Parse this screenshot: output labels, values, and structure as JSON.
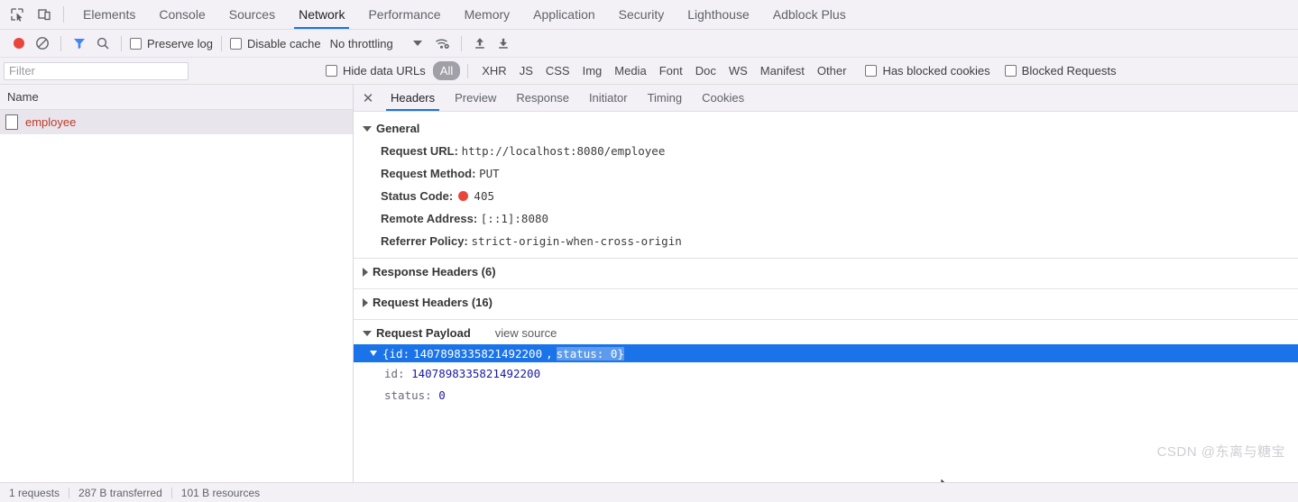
{
  "window": {
    "title": "Chrome DevTools - Network"
  },
  "tabbar": {
    "inspect_icon": "inspect-element-icon",
    "device_icon": "device-toolbar-icon",
    "tabs": [
      {
        "label": "Elements",
        "active": false
      },
      {
        "label": "Console",
        "active": false
      },
      {
        "label": "Sources",
        "active": false
      },
      {
        "label": "Network",
        "active": true
      },
      {
        "label": "Performance",
        "active": false
      },
      {
        "label": "Memory",
        "active": false
      },
      {
        "label": "Application",
        "active": false
      },
      {
        "label": "Security",
        "active": false
      },
      {
        "label": "Lighthouse",
        "active": false
      },
      {
        "label": "Adblock Plus",
        "active": false
      }
    ]
  },
  "toolbar": {
    "record_icon": "record-button-icon",
    "clear_icon": "clear-icon",
    "filter_icon": "filter-funnel-icon",
    "search_icon": "search-icon",
    "preserve_log_label": "Preserve log",
    "disable_cache_label": "Disable cache",
    "throttling_value": "No throttling",
    "throttling_caret": "chevron-down-icon",
    "network_conditions_icon": "wifi-settings-icon",
    "import_icon": "import-har-icon",
    "export_icon": "export-har-icon",
    "accent_blue": "#1a73e8",
    "record_red": "#e8453c"
  },
  "filterbar": {
    "filter_placeholder": "Filter",
    "filter_value": "",
    "hide_data_urls_label": "Hide data URLs",
    "types": [
      {
        "label": "All",
        "selected": true
      },
      {
        "label": "XHR",
        "selected": false
      },
      {
        "label": "JS",
        "selected": false
      },
      {
        "label": "CSS",
        "selected": false
      },
      {
        "label": "Img",
        "selected": false
      },
      {
        "label": "Media",
        "selected": false
      },
      {
        "label": "Font",
        "selected": false
      },
      {
        "label": "Doc",
        "selected": false
      },
      {
        "label": "WS",
        "selected": false
      },
      {
        "label": "Manifest",
        "selected": false
      },
      {
        "label": "Other",
        "selected": false
      }
    ],
    "has_blocked_cookies_label": "Has blocked cookies",
    "blocked_requests_label": "Blocked Requests"
  },
  "requestlist": {
    "column_header": "Name",
    "rows": [
      {
        "name": "employee",
        "selected": true,
        "error": true
      }
    ]
  },
  "detail": {
    "close_icon": "close-icon",
    "tabs": [
      {
        "label": "Headers",
        "active": true
      },
      {
        "label": "Preview",
        "active": false
      },
      {
        "label": "Response",
        "active": false
      },
      {
        "label": "Initiator",
        "active": false
      },
      {
        "label": "Timing",
        "active": false
      },
      {
        "label": "Cookies",
        "active": false
      }
    ],
    "general": {
      "title": "General",
      "expanded": true,
      "request_url_key": "Request URL:",
      "request_url_value": "http://localhost:8080/employee",
      "request_method_key": "Request Method:",
      "request_method_value": "PUT",
      "status_code_key": "Status Code:",
      "status_code_value": "405",
      "status_icon": "status-error-dot",
      "remote_address_key": "Remote Address:",
      "remote_address_value": "[::1]:8080",
      "referrer_policy_key": "Referrer Policy:",
      "referrer_policy_value": "strict-origin-when-cross-origin"
    },
    "response_headers": {
      "title": "Response Headers (6)",
      "expanded": false
    },
    "request_headers": {
      "title": "Request Headers (16)",
      "expanded": false
    },
    "request_payload": {
      "title": "Request Payload",
      "view_source_label": "view source",
      "expanded": true,
      "root_prefix": "{id: ",
      "root_id": "1407898335821492200",
      "root_mid": ", ",
      "root_selected_text": "status: 0}",
      "entries": [
        {
          "key": "id:",
          "value": "1407898335821492200"
        },
        {
          "key": "status:",
          "value": "0"
        }
      ]
    }
  },
  "statusbar": {
    "requests": "1 requests",
    "transferred": "287 B transferred",
    "resources": "101 B resources"
  },
  "watermark": {
    "text": "CSDN @东离与糖宝"
  }
}
